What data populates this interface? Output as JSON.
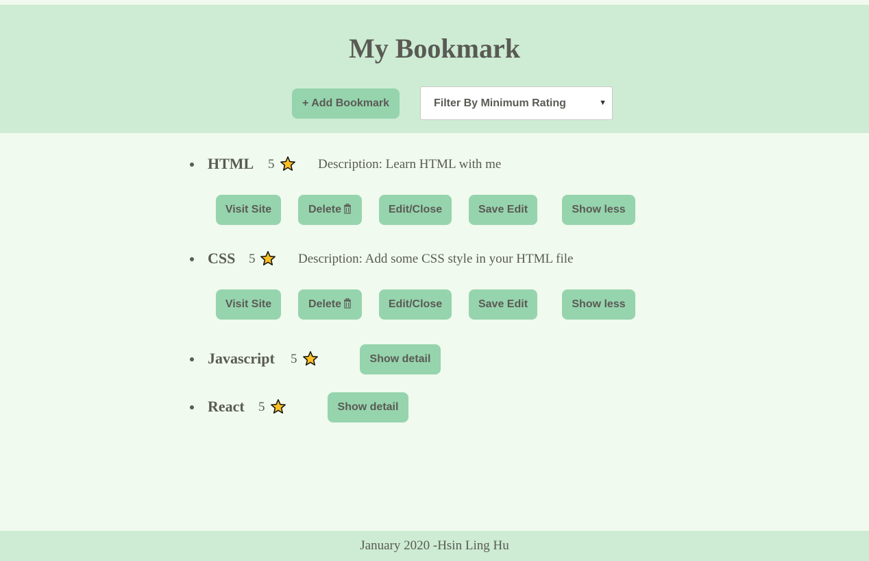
{
  "header": {
    "title": "My Bookmark",
    "add_button_label": "+ Add Bookmark",
    "filter_select": {
      "selected": "Filter By Minimum Rating"
    }
  },
  "bookmarks": [
    {
      "title": "HTML",
      "rating": "5",
      "description": "Description: Learn HTML with me",
      "actions": {
        "visit": "Visit Site",
        "delete": "Delete",
        "edit": "Edit/Close",
        "save": "Save Edit",
        "toggle": "Show less"
      }
    },
    {
      "title": "CSS",
      "rating": "5",
      "description": "Description: Add some CSS style in your HTML file",
      "actions": {
        "visit": "Visit Site",
        "delete": "Delete",
        "edit": "Edit/Close",
        "save": "Save Edit",
        "toggle": "Show less"
      }
    },
    {
      "title": "Javascript",
      "rating": "5",
      "actions": {
        "toggle": "Show detail"
      }
    },
    {
      "title": "React",
      "rating": "5",
      "actions": {
        "toggle": "Show detail"
      }
    }
  ],
  "footer": {
    "text": "January 2020 -Hsin Ling Hu"
  },
  "icons": {
    "rating": "star-icon",
    "delete": "trash-icon",
    "select": "chevron-down-icon"
  },
  "colors": {
    "header_bg": "#cdecd3",
    "page_bg": "#f0faee",
    "button_bg": "#96d4ad",
    "text": "#5a5a55",
    "star_fill": "#fbbf24"
  }
}
